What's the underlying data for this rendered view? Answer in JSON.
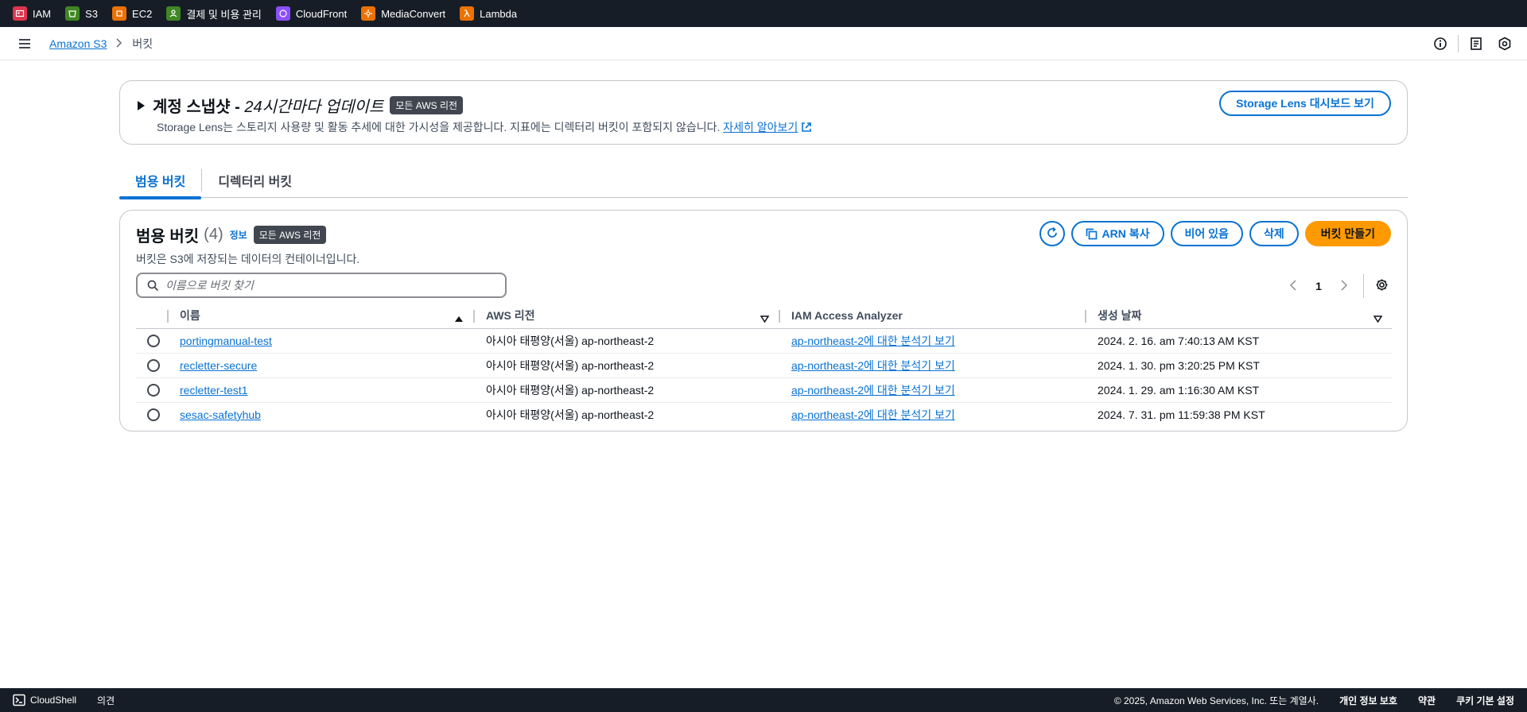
{
  "topbar": {
    "services": [
      {
        "label": "IAM",
        "icon": "iam-icon",
        "color": "#dd344c"
      },
      {
        "label": "S3",
        "icon": "s3-icon",
        "color": "#3f8624"
      },
      {
        "label": "EC2",
        "icon": "ec2-icon",
        "color": "#ed7100"
      },
      {
        "label": "결제 및 비용 관리",
        "icon": "billing-icon",
        "color": "#3f8624"
      },
      {
        "label": "CloudFront",
        "icon": "cloudfront-icon",
        "color": "#8c4fff"
      },
      {
        "label": "MediaConvert",
        "icon": "mediaconvert-icon",
        "color": "#ed7100"
      },
      {
        "label": "Lambda",
        "icon": "lambda-icon",
        "color": "#ed7100"
      }
    ]
  },
  "breadcrumb": {
    "root": "Amazon S3",
    "current": "버킷"
  },
  "snapshot": {
    "title": "계정 스냅샷 - ",
    "title_italic": "24시간마다 업데이트",
    "badge": "모든 AWS 리전",
    "description": "Storage Lens는 스토리지 사용량 및 활동 추세에 대한 가시성을 제공합니다. 지표에는 디렉터리 버킷이 포함되지 않습니다. ",
    "learn_more": "자세히 알아보기",
    "dashboard_button": "Storage Lens 대시보드 보기"
  },
  "tabs": [
    {
      "label": "범용 버킷",
      "active": true
    },
    {
      "label": "디렉터리 버킷",
      "active": false
    }
  ],
  "buckets": {
    "title": "범용 버킷",
    "count": "(4)",
    "info": "정보",
    "badge": "모든 AWS 리전",
    "description": "버킷은 S3에 저장되는 데이터의 컨테이너입니다.",
    "actions": {
      "copy_arn": "ARN 복사",
      "empty": "비어 있음",
      "delete": "삭제",
      "create": "버킷 만들기"
    },
    "search_placeholder": "이름으로 버킷 찾기",
    "page": "1",
    "columns": [
      "이름",
      "AWS 리전",
      "IAM Access Analyzer",
      "생성 날짜"
    ],
    "rows": [
      {
        "name": "portingmanual-test",
        "region": "아시아 태평양(서울) ap-northeast-2",
        "analyzer": "ap-northeast-2에 대한 분석기 보기",
        "created": "2024. 2. 16. am 7:40:13 AM KST"
      },
      {
        "name": "recletter-secure",
        "region": "아시아 태평양(서울) ap-northeast-2",
        "analyzer": "ap-northeast-2에 대한 분석기 보기",
        "created": "2024. 1. 30. pm 3:20:25 PM KST"
      },
      {
        "name": "recletter-test1",
        "region": "아시아 태평양(서울) ap-northeast-2",
        "analyzer": "ap-northeast-2에 대한 분석기 보기",
        "created": "2024. 1. 29. am 1:16:30 AM KST"
      },
      {
        "name": "sesac-safetyhub",
        "region": "아시아 태평양(서울) ap-northeast-2",
        "analyzer": "ap-northeast-2에 대한 분석기 보기",
        "created": "2024. 7. 31. pm 11:59:38 PM KST"
      }
    ]
  },
  "footer": {
    "cloudshell": "CloudShell",
    "feedback": "의견",
    "copyright": "© 2025, Amazon Web Services, Inc. 또는 계열사.",
    "privacy": "개인 정보 보호",
    "terms": "약관",
    "cookies": "쿠키 기본 설정"
  }
}
